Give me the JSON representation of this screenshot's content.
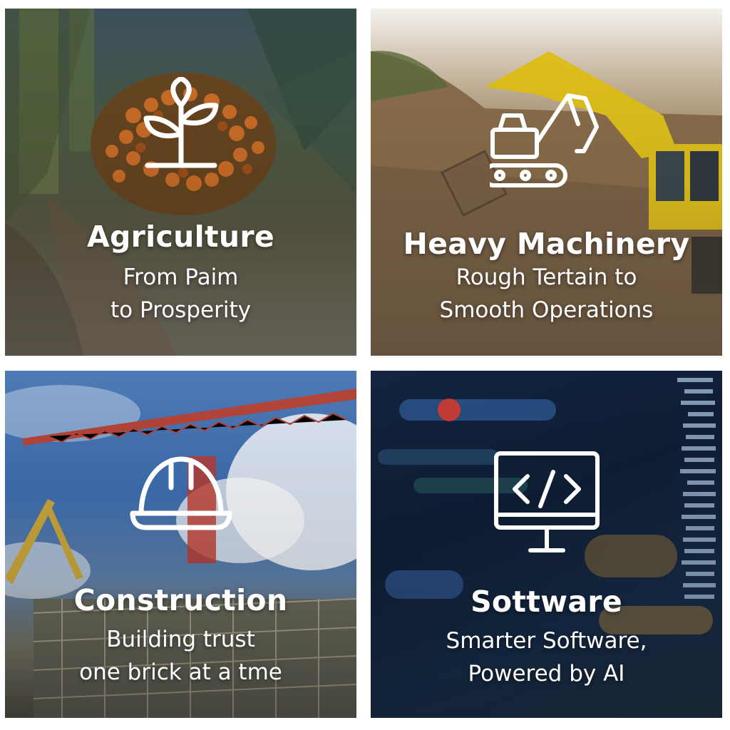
{
  "tiles": [
    {
      "title": "Agriculture",
      "subtitle_lines": [
        "From Paim",
        "to Prosperity"
      ],
      "icon": "plant-sprout-icon"
    },
    {
      "title": "Heavy Machinery",
      "subtitle_lines": [
        "Rough Tertain to",
        "Smooth Operations"
      ],
      "icon": "excavator-icon"
    },
    {
      "title": "Construction",
      "subtitle_lines": [
        "Building trust",
        "one brick at a tme"
      ],
      "icon": "hard-hat-icon"
    },
    {
      "title": "Sottware",
      "subtitle_lines": [
        "Smarter Software,",
        "Powered by AI"
      ],
      "icon": "code-monitor-icon"
    }
  ],
  "colors": {
    "text": "#ffffff",
    "excavator_yellow": "#e2c21c",
    "crane_red": "#b5453a",
    "fruit_orange": "#d9752a",
    "code_red": "#e03a2a",
    "code_blue": "#3b6fb5"
  }
}
